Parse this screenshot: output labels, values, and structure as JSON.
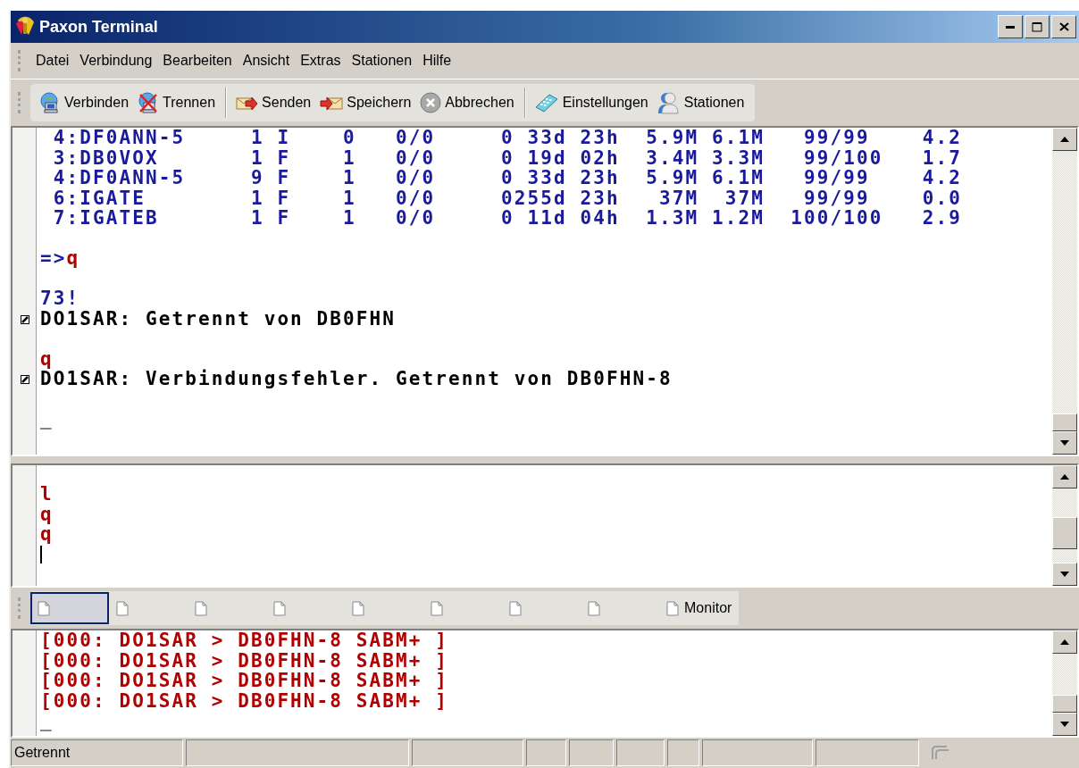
{
  "window": {
    "title": "Paxon Terminal"
  },
  "menu": [
    "Datei",
    "Verbindung",
    "Bearbeiten",
    "Ansicht",
    "Extras",
    "Stationen",
    "Hilfe"
  ],
  "toolbar": [
    [
      "Verbinden",
      "Trennen"
    ],
    [
      "Senden",
      "Speichern",
      "Abbrechen"
    ],
    [
      "Einstellungen",
      "Stationen"
    ]
  ],
  "terminal": {
    "lines": [
      {
        "kind": "station",
        "text": " 4:DF0ANN-5     1 I    0   0/0     0 33d 23h  5.9M 6.1M   99/99    4.2"
      },
      {
        "kind": "station",
        "text": " 3:DB0VOX       1 F    1   0/0     0 19d 02h  3.4M 3.3M   99/100   1.7"
      },
      {
        "kind": "station",
        "text": " 4:DF0ANN-5     9 F    1   0/0     0 33d 23h  5.9M 6.1M   99/99    4.2"
      },
      {
        "kind": "station",
        "text": " 6:IGATE        1 F    1   0/0     0255d 23h   37M  37M   99/99    0.0"
      },
      {
        "kind": "station",
        "text": " 7:IGATEB       1 F    1   0/0     0 11d 04h  1.3M 1.2M  100/100   2.9"
      },
      {
        "kind": "blank"
      },
      {
        "kind": "prompt",
        "prompt": "=>",
        "input": "q"
      },
      {
        "kind": "blank"
      },
      {
        "kind": "reply",
        "text": "73!"
      },
      {
        "kind": "status",
        "text": "DO1SAR: Getrennt von DB0FHN"
      },
      {
        "kind": "blank"
      },
      {
        "kind": "echo",
        "text": "q"
      },
      {
        "kind": "status",
        "text": "DO1SAR: Verbindungsfehler. Getrennt von DB0FHN-8"
      },
      {
        "kind": "blank"
      },
      {
        "kind": "cursor",
        "text": "_"
      }
    ]
  },
  "input": {
    "lines": [
      {
        "kind": "echo",
        "text": "l"
      },
      {
        "kind": "echo",
        "text": "q"
      },
      {
        "kind": "echo",
        "text": "q"
      },
      {
        "kind": "caret"
      }
    ]
  },
  "tabs": [
    {
      "selected": true
    },
    {
      "selected": false
    },
    {
      "selected": false
    },
    {
      "selected": false
    },
    {
      "selected": false
    },
    {
      "selected": false
    },
    {
      "selected": false
    },
    {
      "selected": false
    },
    {
      "label": "Monitor",
      "selected": false
    }
  ],
  "monitor": {
    "lines": [
      {
        "kind": "frame",
        "text": "[000: DO1SAR > DB0FHN-8 SABM+ ]"
      },
      {
        "kind": "frame",
        "text": "[000: DO1SAR > DB0FHN-8 SABM+ ]"
      },
      {
        "kind": "frame",
        "text": "[000: DO1SAR > DB0FHN-8 SABM+ ]"
      },
      {
        "kind": "frame",
        "text": "[000: DO1SAR > DB0FHN-8 SABM+ ]"
      },
      {
        "kind": "cursor",
        "text": "_"
      }
    ]
  },
  "status_bar": {
    "text": "Getrennt"
  }
}
